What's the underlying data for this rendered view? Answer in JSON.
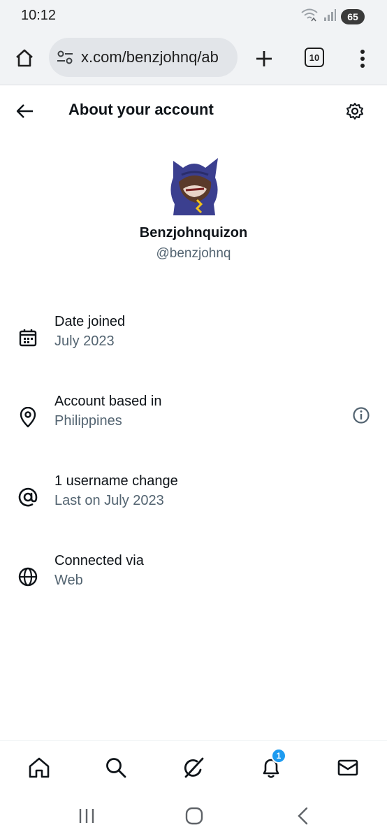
{
  "status_bar": {
    "time": "10:12",
    "battery": "65"
  },
  "browser": {
    "url": "x.com/benzjohnq/ab",
    "tab_count": "10"
  },
  "header": {
    "title": "About your account"
  },
  "profile": {
    "display_name": "Benzjohnquizon",
    "handle": "@benzjohnq"
  },
  "info_rows": [
    {
      "icon": "calendar-icon",
      "label": "Date joined",
      "value": "July 2023"
    },
    {
      "icon": "location-pin-icon",
      "label": "Account based in",
      "value": "Philippines"
    },
    {
      "icon": "at-sign-icon",
      "label": "1 username change",
      "value": "Last on July 2023"
    },
    {
      "icon": "globe-icon",
      "label": "Connected via",
      "value": "Web"
    }
  ],
  "bottom_nav": {
    "items": [
      "home-icon",
      "search-icon",
      "grok-icon",
      "bell-icon",
      "mail-icon"
    ],
    "notification_count": "1"
  },
  "colors": {
    "text": "#0f1419",
    "secondary": "#536471",
    "accent": "#1d9bf0",
    "browser_bg": "#f1f3f5"
  }
}
